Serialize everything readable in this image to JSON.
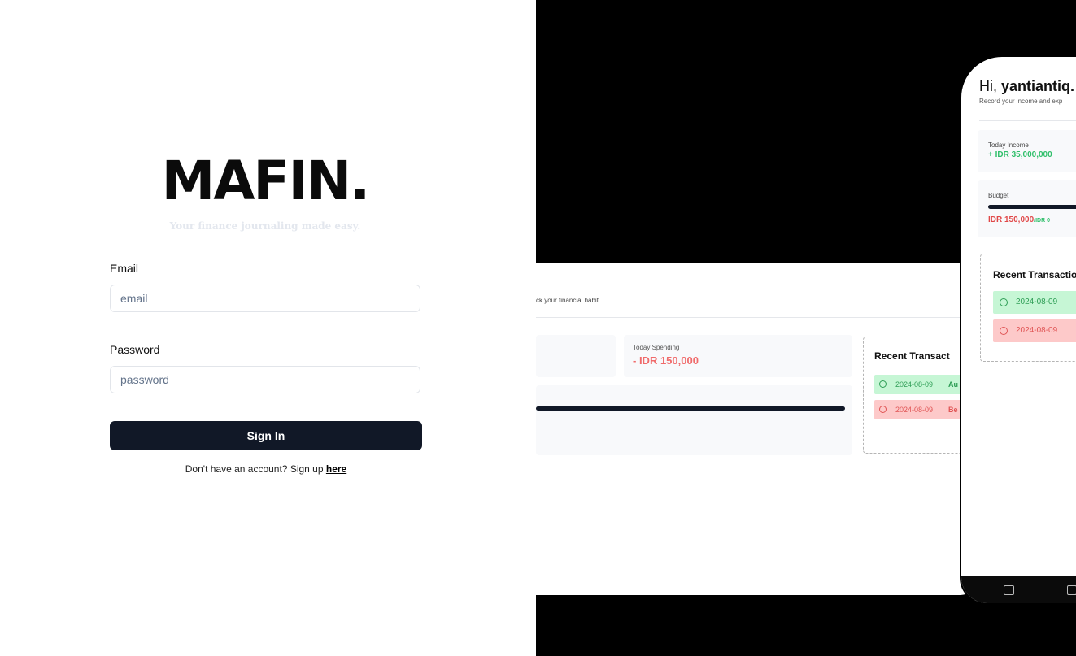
{
  "login": {
    "logo": "MAFIN.",
    "tagline": "Your finance journaling made easy.",
    "email_label": "Email",
    "email_placeholder": "email",
    "password_label": "Password",
    "password_placeholder": "password",
    "signin_label": "Sign In",
    "signup_prefix": "Don't have an account? Sign up ",
    "signup_link": "here"
  },
  "desktop_preview": {
    "subtitle": "ck your financial habit.",
    "spending_label": "Today Spending",
    "spending_value": "- IDR 150,000",
    "recent_title": "Recent Transact",
    "transactions": [
      {
        "date": "2024-08-09",
        "name": "Au",
        "type": "income"
      },
      {
        "date": "2024-08-09",
        "name": "Be",
        "type": "expense"
      }
    ]
  },
  "phone_preview": {
    "greeting": "Hi, ",
    "username": "yantiantiq.",
    "subtitle": "Record your income and exp",
    "income_label": "Today Income",
    "income_value": "+ IDR 35,000,000",
    "budget_label": "Budget",
    "budget_value": "IDR 150,000",
    "budget_total": "/IDR 0",
    "recent_title": "Recent Transactio",
    "transactions": [
      {
        "date": "2024-08-09",
        "type": "income"
      },
      {
        "date": "2024-08-09",
        "type": "expense"
      }
    ],
    "nav_icons": [
      "home-icon",
      "wallet-icon"
    ]
  },
  "colors": {
    "primary": "#111827",
    "income": "#2fbf6a",
    "expense": "#e04848",
    "income_bg": "#c6f6d5",
    "expense_bg": "#fdc9c9"
  }
}
